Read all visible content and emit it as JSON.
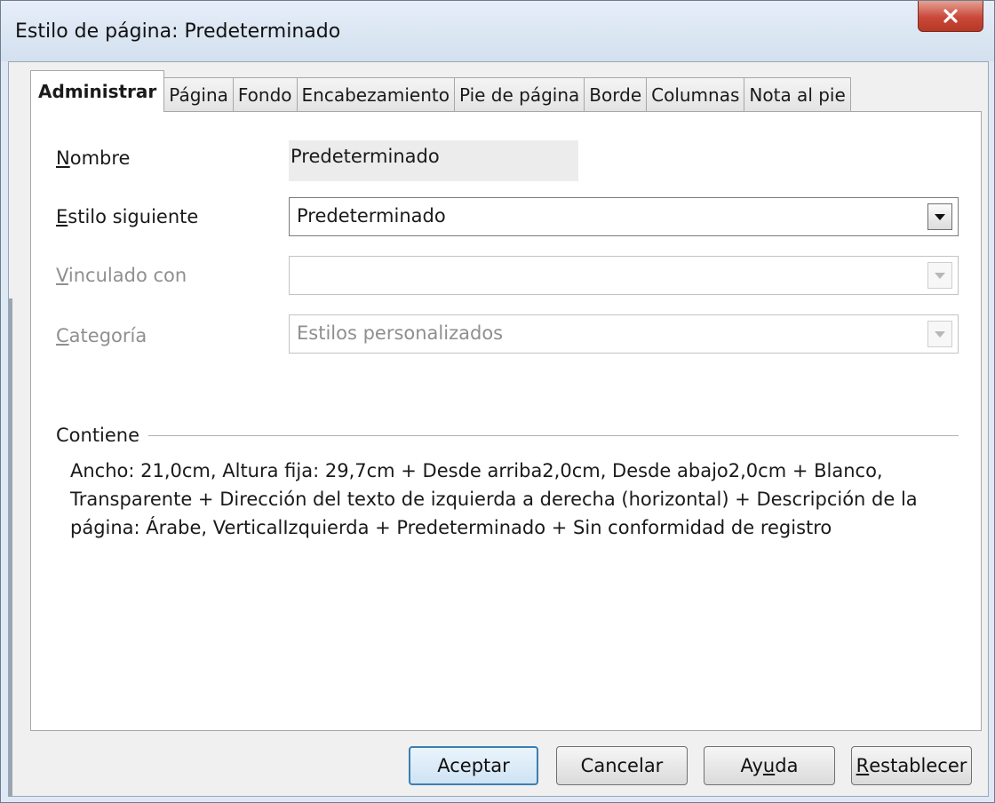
{
  "window": {
    "title": "Estilo de página: Predeterminado",
    "close_icon": "close-icon"
  },
  "tabs": [
    {
      "label": "Administrar",
      "active": true
    },
    {
      "label": "Página"
    },
    {
      "label": "Fondo"
    },
    {
      "label": "Encabezamiento"
    },
    {
      "label": "Pie de página"
    },
    {
      "label": "Borde"
    },
    {
      "label": "Columnas"
    },
    {
      "label": "Nota al pie"
    }
  ],
  "form": {
    "nombre": {
      "label_mn": "N",
      "label_rest": "ombre",
      "value": "Predeterminado"
    },
    "estilo_siguiente": {
      "label_mn": "E",
      "label_rest": "stilo siguiente",
      "value": "Predeterminado"
    },
    "vinculado_con": {
      "label_mn": "V",
      "label_rest": "inculado con",
      "value": ""
    },
    "categoria": {
      "label_mn": "C",
      "label_rest": "ategoría",
      "value": "Estilos personalizados"
    }
  },
  "contains": {
    "heading": "Contiene",
    "text": "Ancho: 21,0cm, Altura fija: 29,7cm + Desde arriba2,0cm, Desde abajo2,0cm + Blanco, Transparente + Dirección del texto de izquierda a derecha (horizontal) + Descripción de la página:  Árabe, VerticalIzquierda + Predeterminado + Sin conformidad de registro"
  },
  "buttons": {
    "ok": "Aceptar",
    "cancel": "Cancelar",
    "help_pre": "Ay",
    "help_mn": "u",
    "help_post": "da",
    "reset_mn": "R",
    "reset_post": "establecer"
  },
  "colors": {
    "accent": "#3c7fb1",
    "close": "#c9483a"
  }
}
